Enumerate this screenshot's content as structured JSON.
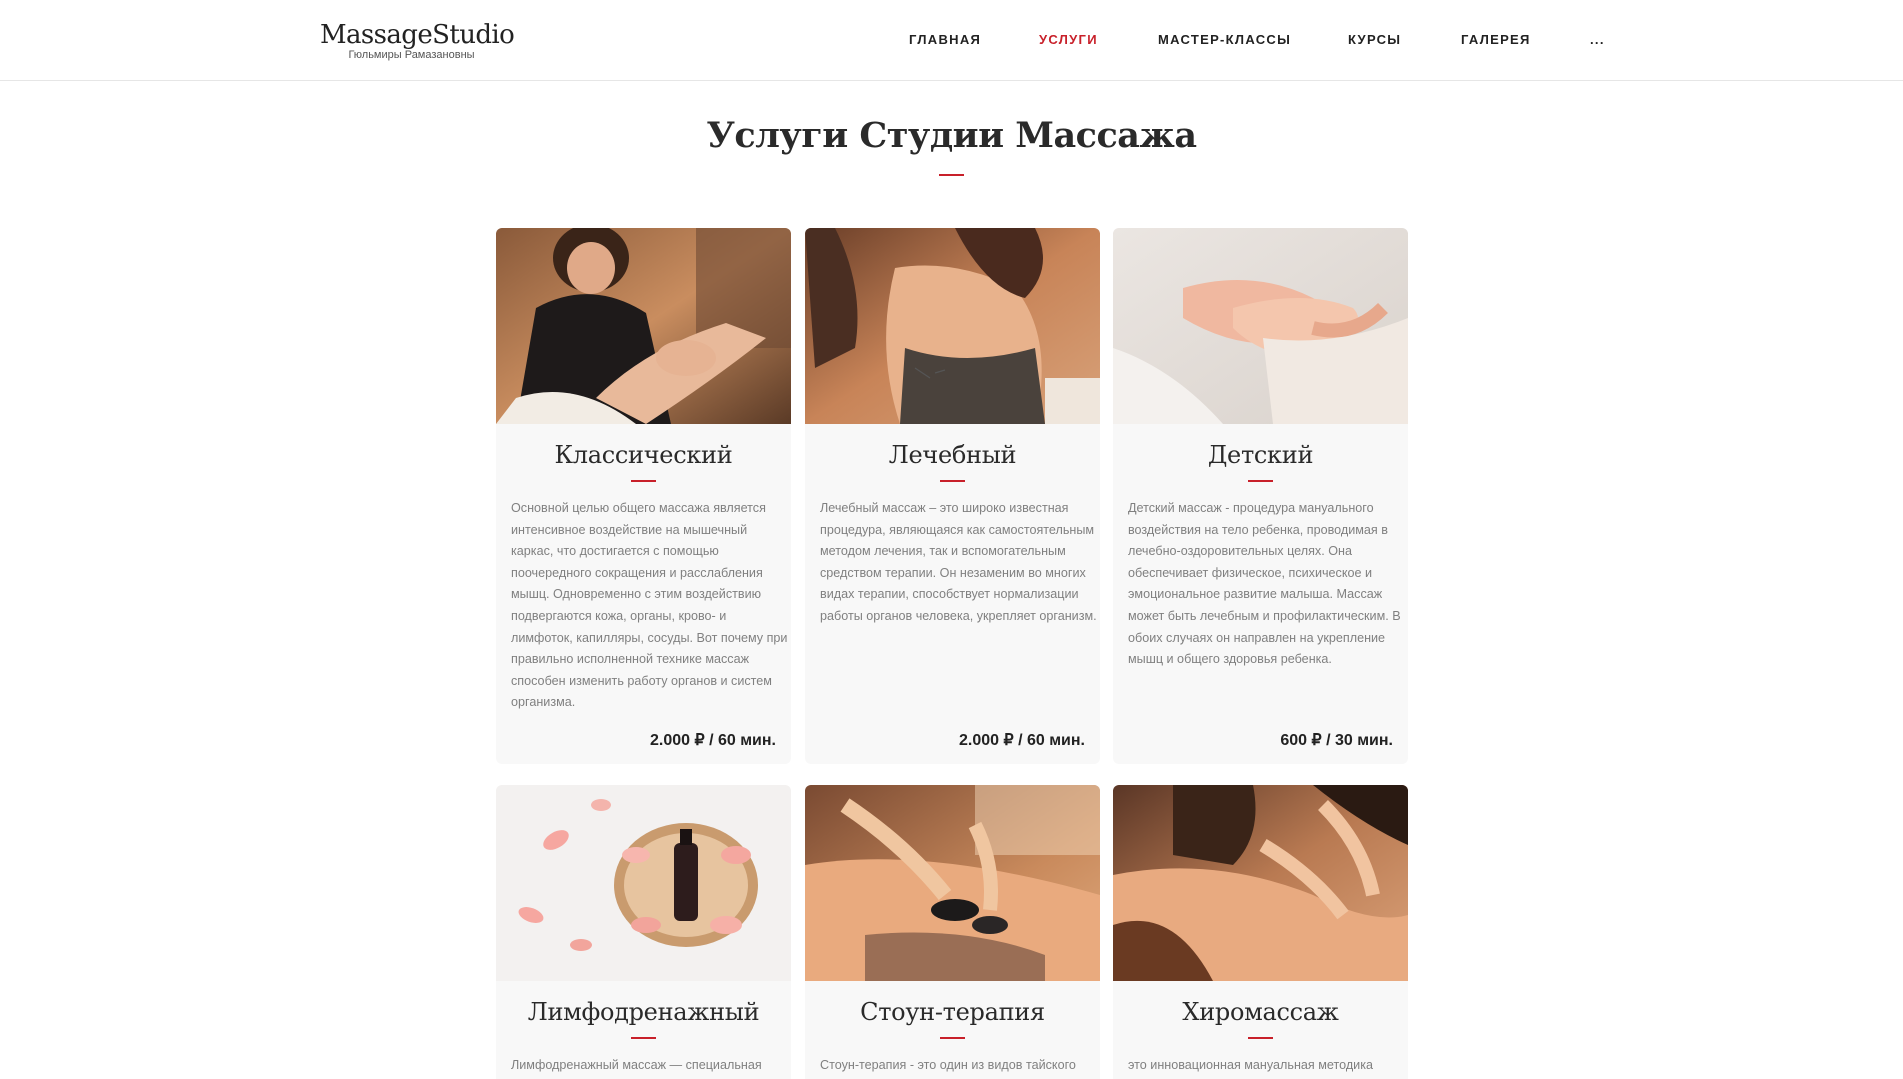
{
  "header": {
    "logo_title": "MassageStudio",
    "logo_subtitle": "Гюльмиры Рамазановны",
    "nav": [
      {
        "label": "ГЛАВНАЯ"
      },
      {
        "label": "УСЛУГИ",
        "active": true
      },
      {
        "label": "МАСТЕР-КЛАССЫ"
      },
      {
        "label": "КУРСЫ"
      },
      {
        "label": "ГАЛЕРЕЯ"
      },
      {
        "label": "..."
      }
    ]
  },
  "main": {
    "title": "Услуги Студии Массажа",
    "accent_color": "#c8202a",
    "cards": [
      {
        "name": "Классический",
        "image": "photo: massage therapist working on client's feet",
        "description": "Основной целью общего массажа является интенсивное воздействие на мышечный каркас, что достигается с помощью поочередного сокращения и расслабления мышц. Одновременно с этим воздействию подвергаются кожа, органы, крово- и лимфоток, капилляры, сосуды. Вот почему при правильно исполненной технике массаж способен изменить работу органов и систем организма.",
        "price": "2.000 ₽ / 60 мин."
      },
      {
        "name": "Лечебный",
        "image": "photo: back massage with acupuncture needles",
        "description": "Лечебный массаж – это широко известная процедура, являющаяся как самостоятельным методом лечения, так и вспомогательным средством терапии. Он незаменим во многих видах терапии, способствует нормализации работы органов человека, укрепляет организм.",
        "price": "2.000 ₽ / 60 мин."
      },
      {
        "name": "Детский",
        "image": "photo: hands massaging a child's arm",
        "description": "Детский массаж - процедура мануального воздействия на тело ребенка, проводимая в лечебно-оздоровительных целях. Она обеспечивает физическое, психическое и эмоциональное развитие малыша. Массаж может быть лечебным и профилактическим. В обоих случаях он направлен на укрепление мышц и общего здоровья ребенка.",
        "price": "600 ₽ / 30 мин."
      },
      {
        "name": "Лимфодренажный",
        "image": "photo: oil bottle among rose petals",
        "description": "Лимфодренажный массаж — специальная",
        "price": ""
      },
      {
        "name": "Стоун-терапия",
        "image": "photo: hot stones on client's back",
        "description": "Стоун-терапия - это один из видов тайского",
        "price": ""
      },
      {
        "name": "Хиромассаж",
        "image": "photo: back massage in warm light",
        "description": "это инновационная мануальная методика",
        "price": ""
      }
    ]
  }
}
